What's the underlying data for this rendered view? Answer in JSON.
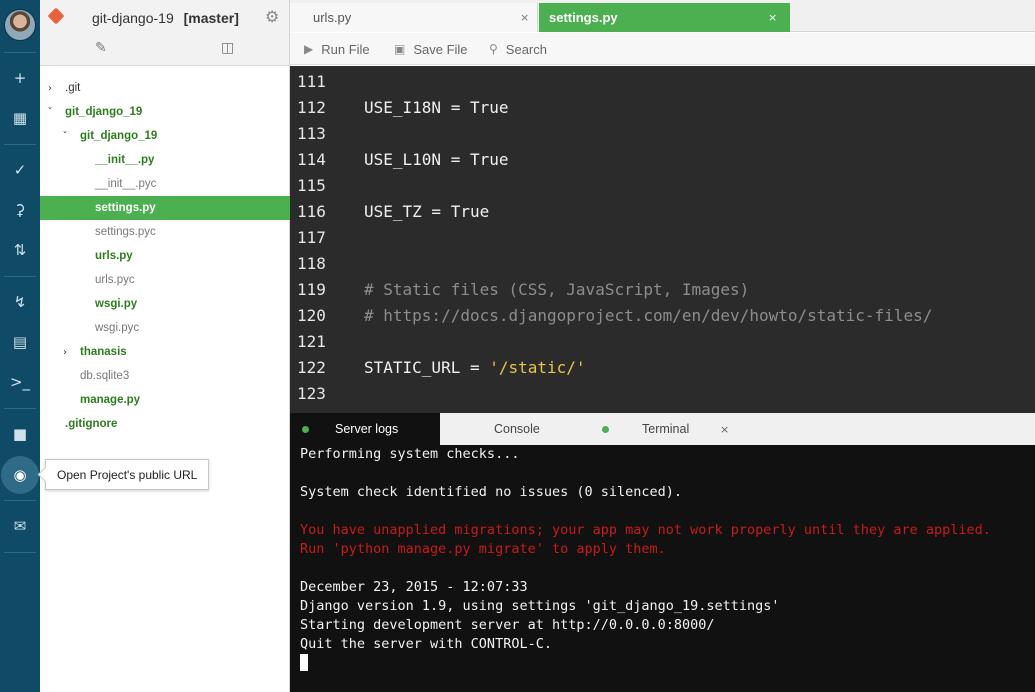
{
  "sidebar": {
    "icons": [
      "avatar",
      "plus-icon",
      "grid-icon",
      "check-icon",
      "commit-icon",
      "branch-icon",
      "bolt-icon",
      "document-icon",
      "terminal-icon",
      "stop-icon",
      "eye-icon",
      "mail-icon"
    ],
    "tooltip": "Open Project's public URL"
  },
  "tree_panel": {
    "project_name": "git-django-19",
    "branch": "[master]",
    "items": [
      {
        "label": ".git",
        "type": "folder",
        "expanded": false
      },
      {
        "label": "git_django_19",
        "type": "folder",
        "expanded": true
      },
      {
        "label": "git_django_19",
        "type": "folder",
        "expanded": true
      },
      {
        "label": "__init__.py",
        "type": "file"
      },
      {
        "label": "__init__.pyc",
        "type": "file"
      },
      {
        "label": "settings.py",
        "type": "file",
        "selected": true
      },
      {
        "label": "settings.pyc",
        "type": "file"
      },
      {
        "label": "urls.py",
        "type": "file"
      },
      {
        "label": "urls.pyc",
        "type": "file"
      },
      {
        "label": "wsgi.py",
        "type": "file"
      },
      {
        "label": "wsgi.pyc",
        "type": "file"
      },
      {
        "label": "thanasis",
        "type": "folder",
        "expanded": false
      },
      {
        "label": "db.sqlite3",
        "type": "file"
      },
      {
        "label": "manage.py",
        "type": "file"
      },
      {
        "label": ".gitignore",
        "type": "file"
      }
    ]
  },
  "editor": {
    "tabs": [
      {
        "label": "urls.py",
        "close": "×"
      },
      {
        "label": "settings.py",
        "close": "×",
        "active": true
      }
    ],
    "toolbar": {
      "run": "Run File",
      "save": "Save File",
      "search": "Search"
    },
    "lines": [
      {
        "num": "111",
        "code": ""
      },
      {
        "num": "112",
        "code": "USE_I18N = True"
      },
      {
        "num": "113",
        "code": ""
      },
      {
        "num": "114",
        "code": "USE_L10N = True"
      },
      {
        "num": "115",
        "code": ""
      },
      {
        "num": "116",
        "code": "USE_TZ = True"
      },
      {
        "num": "117",
        "code": ""
      },
      {
        "num": "118",
        "code": ""
      },
      {
        "num": "119",
        "code": "# Static files (CSS, JavaScript, Images)"
      },
      {
        "num": "120",
        "code": "# https://docs.djangoproject.com/en/dev/howto/static-files/"
      },
      {
        "num": "121",
        "code": ""
      },
      {
        "num": "122",
        "code_pre": "STATIC_URL = ",
        "code_str": "'/static/'"
      },
      {
        "num": "123",
        "code": ""
      }
    ]
  },
  "bottom": {
    "tabs": [
      {
        "label": "Server logs",
        "active": true
      },
      {
        "label": "Console"
      },
      {
        "label": "Terminal",
        "close": "×"
      }
    ],
    "output": [
      "Performing system checks...",
      "",
      "System check identified no issues (0 silenced).",
      "",
      "You have unapplied migrations; your app may not work properly until they are applied.",
      "Run 'python manage.py migrate' to apply them.",
      "",
      "December 23, 2015 - 12:07:33",
      "Django version 1.9, using settings 'git_django_19.settings'",
      "Starting development server at http://0.0.0.0:8000/",
      "Quit the server with CONTROL-C."
    ]
  },
  "colors": {
    "rail": "#0f4a66",
    "accent_green": "#4caf50",
    "editor_bg": "#2b2b2b",
    "terminal_bg": "#111111",
    "error_red": "#c81b1b",
    "string_yellow": "#e8c547"
  }
}
